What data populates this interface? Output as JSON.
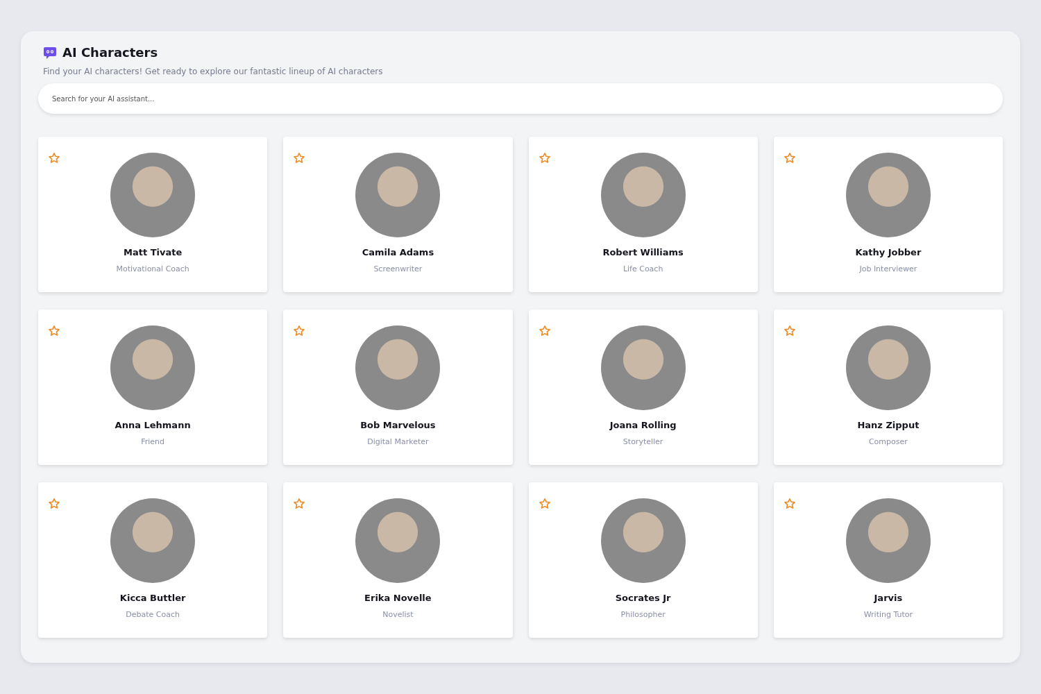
{
  "header": {
    "title": "AI Characters",
    "subtitle": "Find your AI characters! Get ready to explore our fantastic lineup of AI characters"
  },
  "search": {
    "placeholder": "Search for your AI assistant..."
  },
  "characters": [
    {
      "name": "Matt Tivate",
      "role": "Motivational Coach",
      "favorite": false
    },
    {
      "name": "Camila Adams",
      "role": "Screenwriter",
      "favorite": false
    },
    {
      "name": "Robert Williams",
      "role": "Life Coach",
      "favorite": false
    },
    {
      "name": "Kathy Jobber",
      "role": "Job Interviewer",
      "favorite": false
    },
    {
      "name": "Anna Lehmann",
      "role": "Friend",
      "favorite": false
    },
    {
      "name": "Bob Marvelous",
      "role": "Digital Marketer",
      "favorite": false
    },
    {
      "name": "Joana Rolling",
      "role": "Storyteller",
      "favorite": false
    },
    {
      "name": "Hanz Zipput",
      "role": "Composer",
      "favorite": false
    },
    {
      "name": "Kicca Buttler",
      "role": "Debate Coach",
      "favorite": false
    },
    {
      "name": "Erika Novelle",
      "role": "Novelist",
      "favorite": false
    },
    {
      "name": "Socrates Jr",
      "role": "Philosopher",
      "favorite": false
    },
    {
      "name": "Jarvis",
      "role": "Writing Tutor",
      "favorite": false
    }
  ]
}
